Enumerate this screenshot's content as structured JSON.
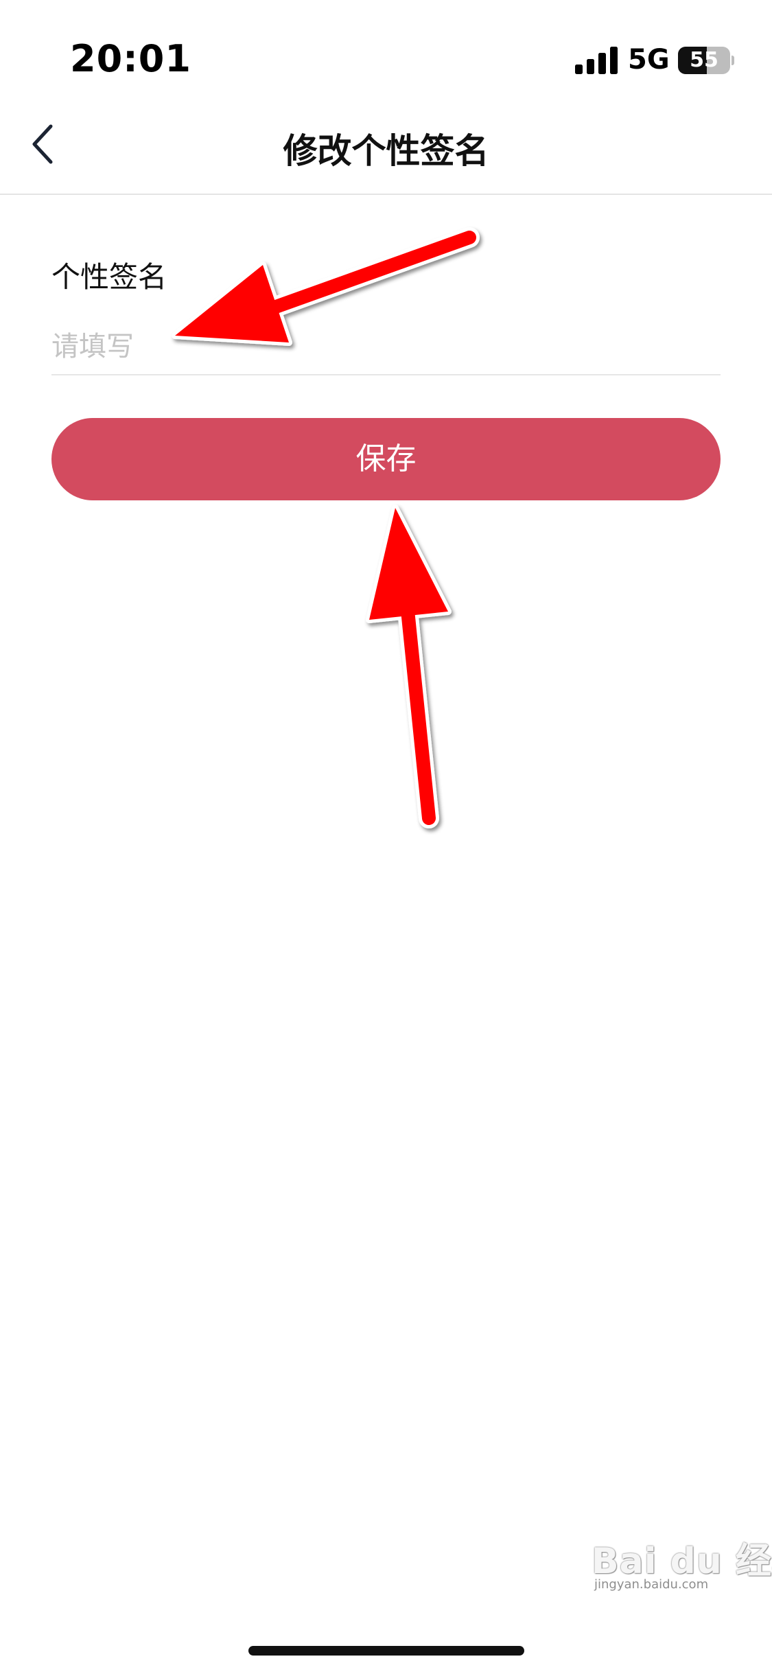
{
  "status_bar": {
    "time": "20:01",
    "network": "5G",
    "battery_level": "55",
    "battery_fraction": 0.55,
    "signal_icon": "cellular-signal-icon",
    "battery_icon": "battery-icon"
  },
  "header": {
    "back_icon": "chevron-left-icon",
    "title": "修改个性签名"
  },
  "form": {
    "label": "个性签名",
    "input_value": "",
    "input_placeholder": "请填写",
    "save_label": "保存"
  },
  "watermark": {
    "text": "Bai du 经验",
    "sub": "jingyan.baidu.com"
  },
  "colors": {
    "accent": "#d34b5f",
    "annotation_arrow": "#ff0000",
    "placeholder": "#c4c4c4",
    "divider": "#e4e4e4"
  }
}
